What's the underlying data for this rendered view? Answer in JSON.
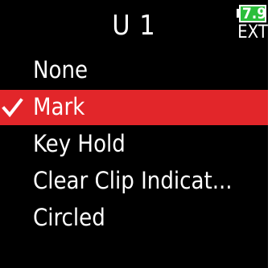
{
  "header": {
    "title": "U 1",
    "battery_level": "7.9",
    "power_source": "EXT"
  },
  "menu": {
    "selected_index": 1,
    "items": [
      {
        "label": "None",
        "selected": false
      },
      {
        "label": "Mark",
        "selected": true
      },
      {
        "label": "Key Hold",
        "selected": false
      },
      {
        "label": "Clear Clip Indicat...",
        "selected": false
      },
      {
        "label": "Circled",
        "selected": false
      }
    ]
  },
  "colors": {
    "background": "#000000",
    "text": "#ffffff",
    "selection": "#e2262a",
    "battery_fill": "#2bbf3a"
  },
  "icons": {
    "selected_marker": "checkmark-icon",
    "battery": "battery-icon"
  }
}
